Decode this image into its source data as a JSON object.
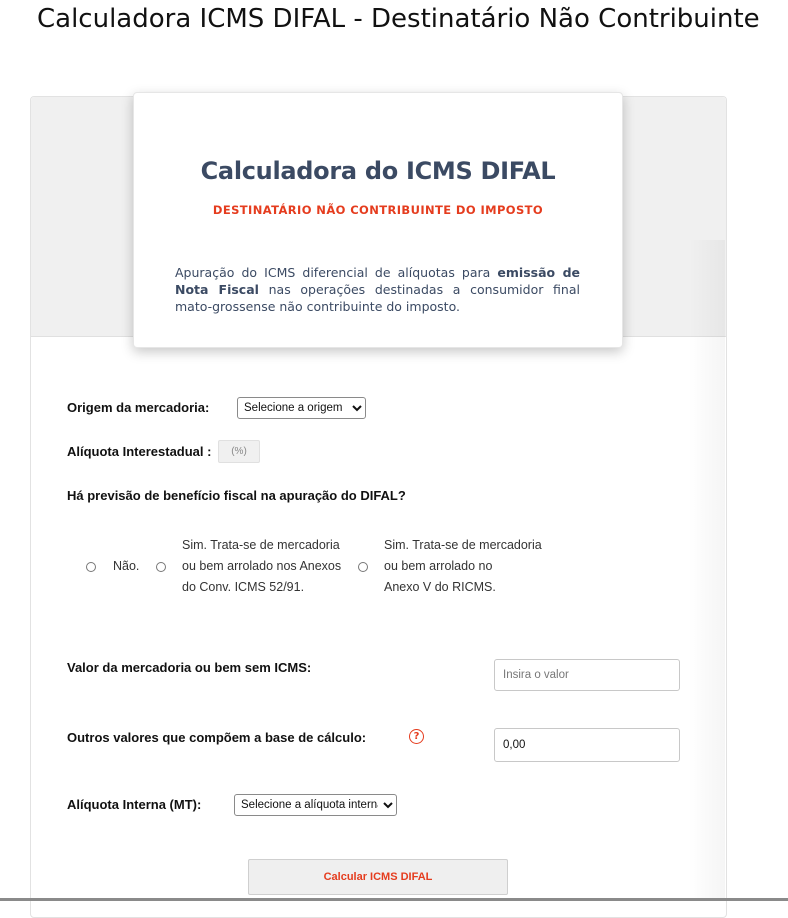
{
  "page": {
    "title": "Calculadora ICMS DIFAL - Destinatário Não Contribuinte"
  },
  "header_card": {
    "title": "Calculadora do ICMS DIFAL",
    "subtitle": "DESTINATÁRIO NÃO CONTRIBUINTE DO IMPOSTO",
    "desc_part1": "Apuração do ICMS diferencial de alíquotas para ",
    "desc_bold": "emissão de Nota Fiscal",
    "desc_part2": " nas operações destinadas a consumidor final mato-grossense não contribuinte do imposto."
  },
  "form": {
    "origem_label": "Origem da mercadoria:",
    "origem_selected": "Selecione a origem",
    "aliquota_interestadual_label": "Alíquota Interestadual :",
    "aliquota_interestadual_placeholder": "(%)",
    "beneficio_question": "Há previsão de benefício fiscal na apuração do DIFAL?",
    "beneficio_options": [
      {
        "label": "Não."
      },
      {
        "line1": "Sim. Trata-se de mercadoria",
        "line2": "ou bem arrolado nos Anexos",
        "line3": "do Conv. ICMS 52/91."
      },
      {
        "line1": "Sim. Trata-se de mercadoria",
        "line2": "ou bem arrolado no",
        "line3": "Anexo V do RICMS."
      }
    ],
    "valor_label": "Valor da mercadoria ou bem sem ICMS:",
    "valor_placeholder": "Insira o valor",
    "outros_label": "Outros valores que compõem a base de cálculo:",
    "outros_value": "0,00",
    "help_icon": "question-circle-icon",
    "aliquota_interna_label": "Alíquota Interna (MT):",
    "aliquota_interna_selected": "Selecione a alíquota interna",
    "calc_button": "Calcular ICMS DIFAL"
  },
  "colors": {
    "accent": "#e53c1e",
    "title_text": "#3b4a63"
  }
}
